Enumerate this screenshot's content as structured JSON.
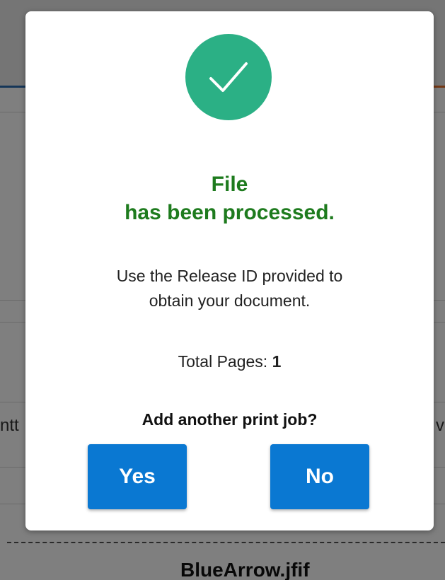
{
  "background": {
    "row_fragment_left": "ntt",
    "row_fragment_right": "v",
    "file_name": "BlueArrow.jfif"
  },
  "dialog": {
    "icon": "checkmark-icon",
    "title_line1": "File",
    "title_line2": "has been processed.",
    "message_line1": "Use the Release ID provided to",
    "message_line2": "obtain your document.",
    "total_pages_label": "Total Pages:",
    "total_pages_value": "1",
    "question": "Add another print job?",
    "yes_label": "Yes",
    "no_label": "No"
  },
  "colors": {
    "success_green": "#2bb085",
    "title_green": "#1e7b1e",
    "button_blue": "#0a78d2"
  }
}
